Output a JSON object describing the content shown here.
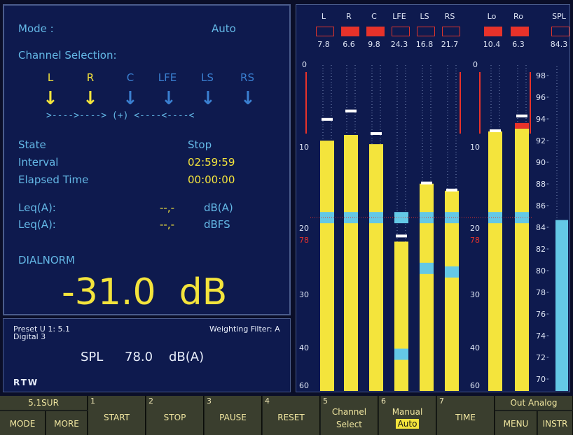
{
  "status": {
    "mode_label": "Mode :",
    "mode_value": "Auto",
    "channel_selection_label": "Channel Selection:",
    "channels": [
      {
        "name": "L",
        "active": true
      },
      {
        "name": "R",
        "active": true
      },
      {
        "name": "C",
        "active": false
      },
      {
        "name": "LFE",
        "active": false
      },
      {
        "name": "LS",
        "active": false
      },
      {
        "name": "RS",
        "active": false
      }
    ],
    "sum_line": ">---->----> (+) <----<----<",
    "state_label": "State",
    "state_value": "Stop",
    "interval_label": "Interval",
    "interval_value": "02:59:59",
    "elapsed_label": "Elapsed Time",
    "elapsed_value": "00:00:00",
    "leq1_label": "Leq(A):",
    "leq1_value": "--,-",
    "leq1_unit": "dB(A)",
    "leq2_label": "Leq(A):",
    "leq2_value": "--,-",
    "leq2_unit": "dBFS",
    "dialnorm_label": "DIALNORM",
    "dialnorm_value": "-31.0  dB"
  },
  "preset": {
    "line1": "Preset U 1: 5.1",
    "line2": "Digital 3",
    "weighting": "Weighting Filter: A",
    "spl_label": "SPL",
    "spl_value": "78.0",
    "spl_unit": "dB(A)",
    "logo": "RTW"
  },
  "meters": {
    "channels": [
      {
        "label": "L",
        "peak": "7.8",
        "over": false,
        "level_db": 10.7,
        "marker_db": 7.8
      },
      {
        "label": "R",
        "peak": "6.6",
        "over": true,
        "level_db": 9.9,
        "marker_db": 6.6
      },
      {
        "label": "C",
        "peak": "9.8",
        "over": true,
        "level_db": 11.2,
        "marker_db": 9.8
      },
      {
        "label": "LFE",
        "peak": "24.3",
        "over": false,
        "level_db": 25.0,
        "marker_db": 24.3
      },
      {
        "label": "LS",
        "peak": "16.8",
        "over": false,
        "level_db": 16.8,
        "marker_db": 16.8
      },
      {
        "label": "RS",
        "peak": "21.7",
        "over": false,
        "level_db": 17.8,
        "marker_db": 17.8
      }
    ],
    "downmix": [
      {
        "label": "Lo",
        "peak": "10.4",
        "over": true,
        "level_db": 9.4,
        "marker_db": 9.4
      },
      {
        "label": "Ro",
        "peak": "6.3",
        "over": true,
        "level_db": 9.0,
        "marker_db": 7.3
      }
    ],
    "spl": {
      "label": "SPL",
      "peak": "84.3",
      "over": false,
      "level": 84.3
    },
    "db_scale": [
      "0",
      "10",
      "20",
      "30",
      "40",
      "60"
    ],
    "ref_label": "78",
    "spl_scale": [
      "98",
      "96",
      "94",
      "92",
      "90",
      "88",
      "86",
      "84",
      "82",
      "80",
      "78",
      "76",
      "74",
      "72",
      "70"
    ]
  },
  "softkeys": {
    "top_left": "5.1SUR",
    "top_right": "Out Analog",
    "keys": [
      {
        "num": "",
        "label": "MODE"
      },
      {
        "num": "",
        "label": "MORE"
      },
      {
        "num": "1",
        "label": "START"
      },
      {
        "num": "2",
        "label": "STOP"
      },
      {
        "num": "3",
        "label": "PAUSE"
      },
      {
        "num": "4",
        "label": "RESET"
      },
      {
        "num": "5",
        "label": "Channel",
        "label2": "Select"
      },
      {
        "num": "6",
        "label": "Manual",
        "label2": "Auto"
      },
      {
        "num": "7",
        "label": "TIME"
      },
      {
        "num": "",
        "label": "MENU"
      },
      {
        "num": "",
        "label": "INSTR"
      }
    ]
  },
  "colors": {
    "bar_yellow": "#f4e43c",
    "bar_cyan": "#64c8e6",
    "over_red": "#e8322a",
    "label_cyan": "#64b8e6",
    "label_yellow": "#f4e43c"
  }
}
